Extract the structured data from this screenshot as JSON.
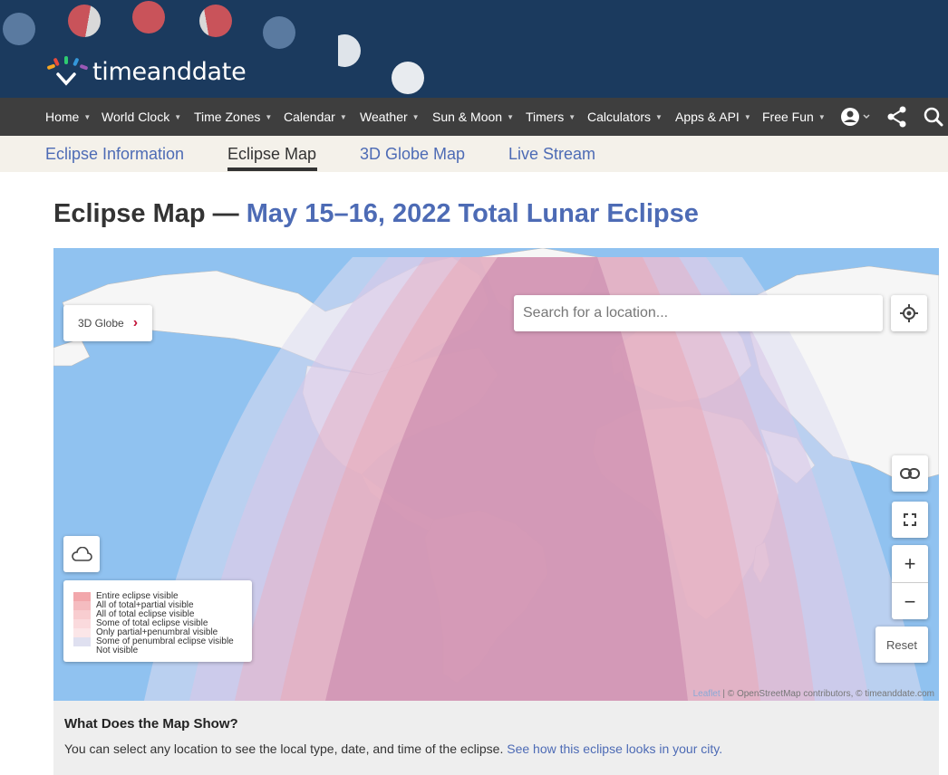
{
  "site": {
    "logo_text": "timeanddate"
  },
  "colors": {
    "header_bg": "#1b3a5e",
    "nav_bg": "#3e3e3e",
    "accent": "#4d6bb5",
    "subnav_bg": "#f4f1ea"
  },
  "nav": {
    "items": [
      {
        "label": "Home"
      },
      {
        "label": "World Clock"
      },
      {
        "label": "Time Zones"
      },
      {
        "label": "Calendar"
      },
      {
        "label": "Weather"
      },
      {
        "label": "Sun & Moon"
      },
      {
        "label": "Timers"
      },
      {
        "label": "Calculators"
      },
      {
        "label": "Apps & API"
      },
      {
        "label": "Free Fun"
      }
    ],
    "icons": [
      "account-icon",
      "share-icon",
      "search-icon"
    ]
  },
  "subnav": {
    "tabs": [
      {
        "label": "Eclipse Information",
        "active": false
      },
      {
        "label": "Eclipse Map",
        "active": true
      },
      {
        "label": "3D Globe Map",
        "active": false
      },
      {
        "label": "Live Stream",
        "active": false
      }
    ]
  },
  "page": {
    "title_prefix": "Eclipse Map — ",
    "title_accent": "May 15–16, 2022 Total Lunar Eclipse"
  },
  "map": {
    "globe_button": "3D Globe",
    "search_placeholder": "Search for a location...",
    "reset_label": "Reset",
    "zoom_in": "+",
    "zoom_out": "−",
    "legend": [
      {
        "label": "Entire eclipse visible",
        "color": "#f2a7ab"
      },
      {
        "label": "All of total+partial visible",
        "color": "#f5bcc0"
      },
      {
        "label": "All of total eclipse visible",
        "color": "#f8cdd0"
      },
      {
        "label": "Some of total eclipse visible",
        "color": "#fadadd"
      },
      {
        "label": "Only partial+penumbral visible",
        "color": "#fbe6e8"
      },
      {
        "label": "Some of penumbral eclipse visible",
        "color": "#dfe0f0"
      },
      {
        "label": "Not visible",
        "color": "#ffffff"
      }
    ],
    "attribution_leaflet": "Leaflet",
    "attribution_rest": " | © OpenStreetMap contributors, © timeanddate.com"
  },
  "info": {
    "heading": "What Does the Map Show?",
    "text": "You can select any location to see the local type, date, and time of the eclipse. ",
    "link": "See how this eclipse looks in your city."
  }
}
